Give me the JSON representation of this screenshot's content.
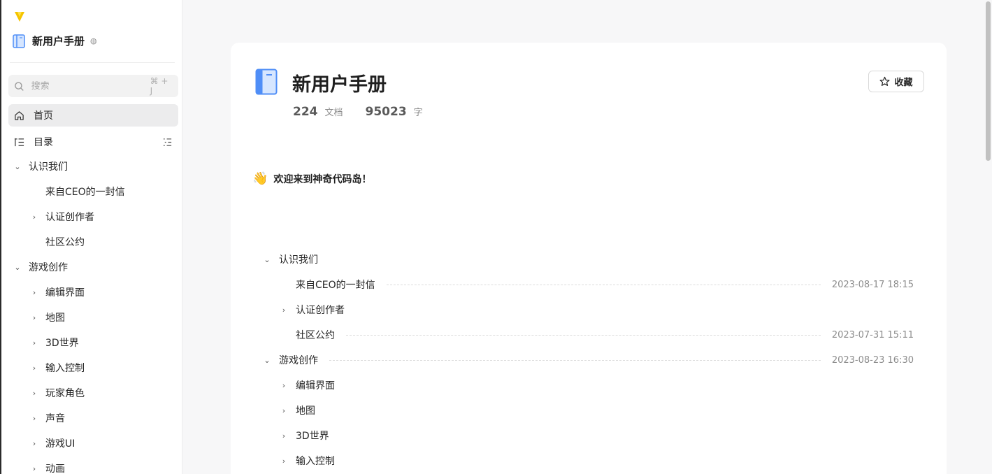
{
  "colors": {
    "logo": "#f5c400",
    "book": "#4f8ef7",
    "active_bg": "#ececed"
  },
  "sidebar": {
    "book_title": "新用户手册",
    "search": {
      "placeholder": "搜索",
      "shortcut": "⌘ + J"
    },
    "home_label": "首页",
    "toc_label": "目录",
    "tree": [
      {
        "label": "认识我们",
        "level": 0,
        "expanded": true
      },
      {
        "label": "来自CEO的一封信",
        "level": 1,
        "leaf": true
      },
      {
        "label": "认证创作者",
        "level": 1
      },
      {
        "label": "社区公约",
        "level": 1,
        "leaf": true
      },
      {
        "label": "游戏创作",
        "level": 0,
        "expanded": true
      },
      {
        "label": "编辑界面",
        "level": 1
      },
      {
        "label": "地图",
        "level": 1
      },
      {
        "label": "3D世界",
        "level": 1
      },
      {
        "label": "输入控制",
        "level": 1
      },
      {
        "label": "玩家角色",
        "level": 1
      },
      {
        "label": "声音",
        "level": 1
      },
      {
        "label": "游戏UI",
        "level": 1
      },
      {
        "label": "动画",
        "level": 1
      }
    ]
  },
  "main": {
    "title": "新用户手册",
    "stats": [
      {
        "value": "224",
        "unit": "文档"
      },
      {
        "value": "95023",
        "unit": "字"
      }
    ],
    "favorite_label": "收藏",
    "welcome": {
      "emoji": "👋",
      "text": "欢迎来到神奇代码岛！"
    },
    "toc": [
      {
        "label": "认识我们",
        "level": 0,
        "expanded": true,
        "date": ""
      },
      {
        "label": "来自CEO的一封信",
        "level": 1,
        "leaf": true,
        "date": "2023-08-17 18:15"
      },
      {
        "label": "认证创作者",
        "level": 1,
        "date": ""
      },
      {
        "label": "社区公约",
        "level": 1,
        "leaf": true,
        "date": "2023-07-31 15:11"
      },
      {
        "label": "游戏创作",
        "level": 0,
        "expanded": true,
        "date": "2023-08-23 16:30"
      },
      {
        "label": "编辑界面",
        "level": 1,
        "date": ""
      },
      {
        "label": "地图",
        "level": 1,
        "date": ""
      },
      {
        "label": "3D世界",
        "level": 1,
        "date": ""
      },
      {
        "label": "输入控制",
        "level": 1,
        "date": ""
      }
    ]
  }
}
